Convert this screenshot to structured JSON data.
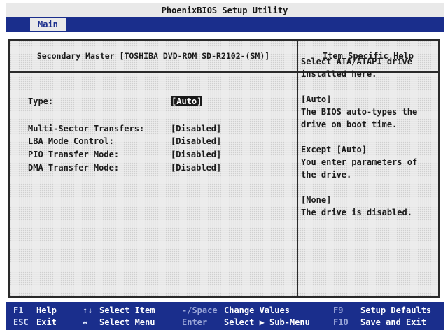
{
  "title": "PhoenixBIOS Setup Utility",
  "menu": {
    "active_tab": "Main"
  },
  "panel": {
    "header": "Secondary Master [TOSHIBA DVD-ROM SD-R2102-(SM)]",
    "help_header": "Item Specific Help"
  },
  "fields": [
    {
      "label": "Type:",
      "value": "[Auto]",
      "selected": true
    },
    {
      "label": "Multi-Sector Transfers:",
      "value": "[Disabled]"
    },
    {
      "label": "LBA Mode Control:",
      "value": "[Disabled]"
    },
    {
      "label": "PIO Transfer Mode:",
      "value": "[Disabled]"
    },
    {
      "label": "DMA Transfer Mode:",
      "value": "[Disabled]"
    }
  ],
  "help_text": "Select ATA/ATAPI drive\ninstalled here.\n\n[Auto]\nThe BIOS auto-types the\ndrive on boot time.\n\nExcept [Auto]\nYou enter parameters of\nthe drive.\n\n[None]\nThe drive is disabled.",
  "status_bar": {
    "f1_key": "F1",
    "f1_label": "Help",
    "esc_key": "ESC",
    "esc_label": "Exit",
    "updown_key": "↑↓",
    "updown_label": "Select Item",
    "leftright_key": "↔",
    "leftright_label": "Select Menu",
    "change_key": "-/Space",
    "change_label": "Change Values",
    "enter_key": "Enter",
    "enter_label": "Select ▶ Sub-Menu",
    "f9_key": "F9",
    "f9_label": "Setup Defaults",
    "f10_key": "F10",
    "f10_label": "Save and Exit"
  },
  "colors": {
    "menu_bar": "#1a2e8c",
    "status_bar": "#1a2e8c",
    "panel_bg": "#ececec",
    "border": "#2a2a2a",
    "selected_bg": "#1a1a1a"
  }
}
